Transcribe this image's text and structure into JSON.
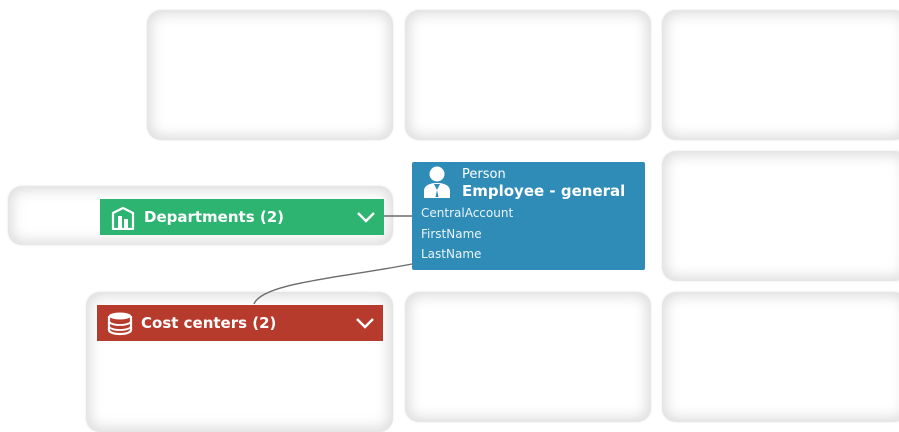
{
  "groups": [
    {
      "label": "Departments (2)",
      "icon": "building-icon",
      "color": "#2db471"
    },
    {
      "label": "Cost centers (2)",
      "icon": "coins-icon",
      "color": "#b73b2c"
    }
  ],
  "entity": {
    "kind": "Person",
    "title": "Employee - general",
    "icon": "person-icon",
    "color": "#2e8cb6",
    "fields": [
      "CentralAccount",
      "FirstName",
      "LastName"
    ]
  }
}
